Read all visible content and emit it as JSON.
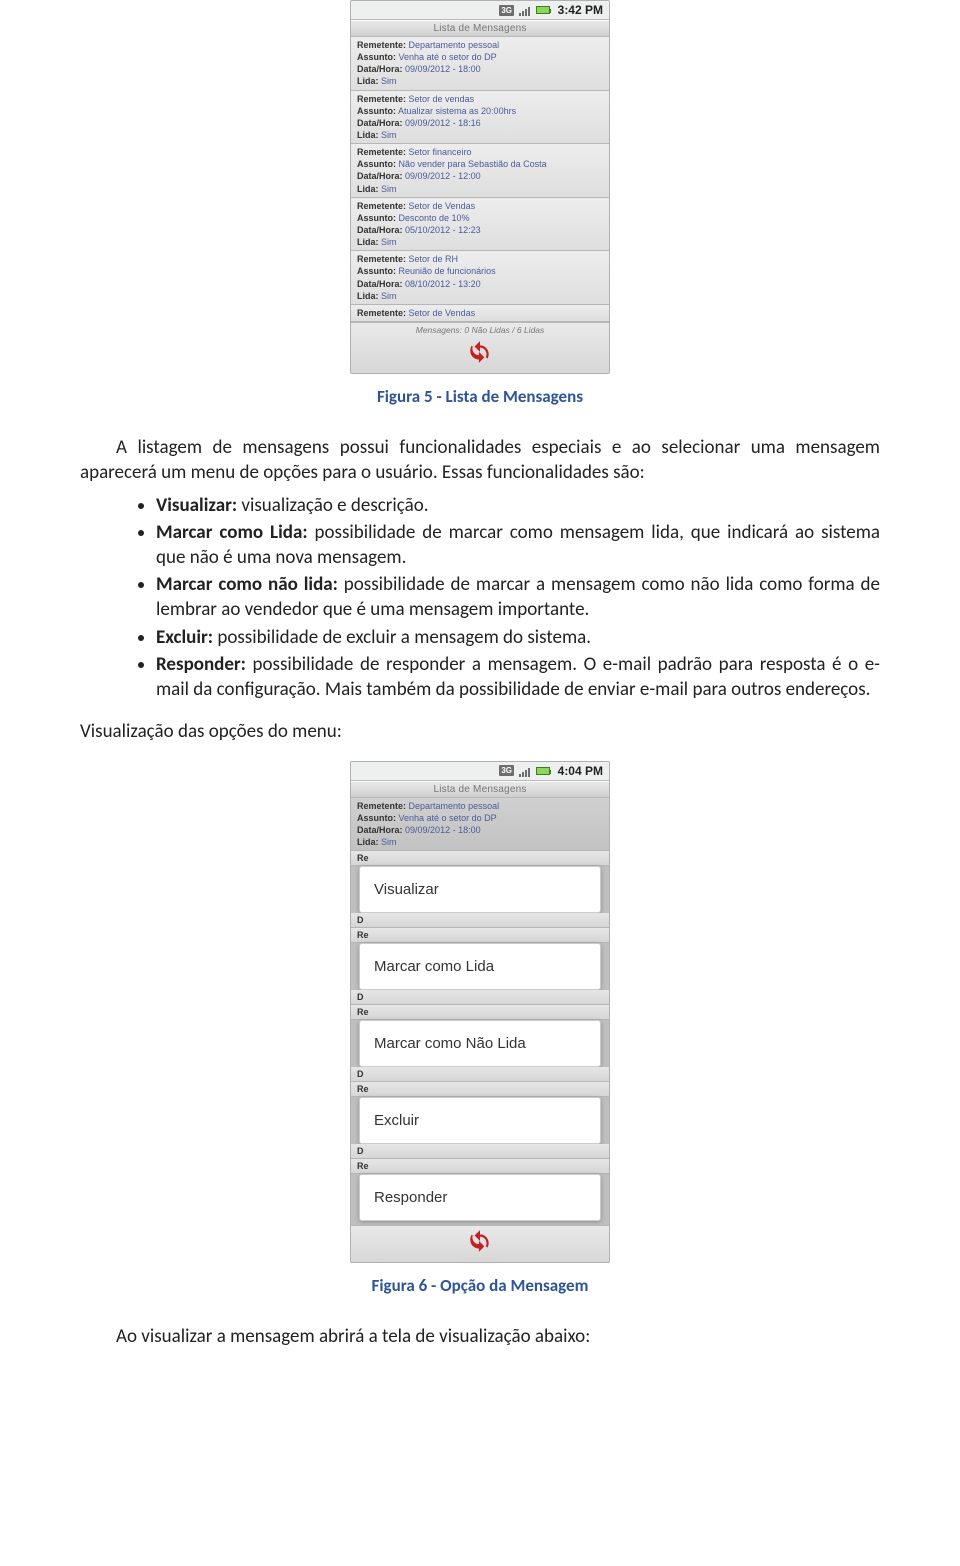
{
  "phone1": {
    "statusbar": {
      "time": "3:42 PM"
    },
    "app_title": "Lista de Mensagens",
    "messages": [
      {
        "remetente_lab": "Remetente:",
        "remetente": "Departamento pessoal",
        "assunto_lab": "Assunto:",
        "assunto": "Venha até o setor do DP",
        "datahora_lab": "Data/Hora:",
        "datahora": "09/09/2012 - 18:00",
        "lida_lab": "Lida:",
        "lida": "Sim"
      },
      {
        "remetente_lab": "Remetente:",
        "remetente": "Setor de vendas",
        "assunto_lab": "Assunto:",
        "assunto": "Atualizar sistema as 20:00hrs",
        "datahora_lab": "Data/Hora:",
        "datahora": "09/09/2012 - 18:16",
        "lida_lab": "Lida:",
        "lida": "Sim"
      },
      {
        "remetente_lab": "Remetente:",
        "remetente": "Setor financeiro",
        "assunto_lab": "Assunto:",
        "assunto": "Não vender para Sebastião da Costa",
        "datahora_lab": "Data/Hora:",
        "datahora": "09/09/2012 - 12:00",
        "lida_lab": "Lida:",
        "lida": "Sim"
      },
      {
        "remetente_lab": "Remetente:",
        "remetente": "Setor de Vendas",
        "assunto_lab": "Assunto:",
        "assunto": "Desconto de 10%",
        "datahora_lab": "Data/Hora:",
        "datahora": "05/10/2012 - 12:23",
        "lida_lab": "Lida:",
        "lida": "Sim"
      },
      {
        "remetente_lab": "Remetente:",
        "remetente": "Setor de RH",
        "assunto_lab": "Assunto:",
        "assunto": "Reunião de funcionários",
        "datahora_lab": "Data/Hora:",
        "datahora": "08/10/2012 - 13:20",
        "lida_lab": "Lida:",
        "lida": "Sim"
      },
      {
        "remetente_lab": "Remetente:",
        "remetente": "Setor de Vendas"
      }
    ],
    "footer_text": "Mensagens: 0 Não Lidas / 6 Lidas"
  },
  "caption1": "Figura 5 - Lista de Mensagens",
  "para1": "A listagem de mensagens possui funcionalidades especiais e ao selecionar uma mensagem aparecerá um menu de opções para o usuário. Essas funcionalidades são:",
  "bullets": [
    {
      "lead": "Visualizar:",
      "text": " visualização e descrição."
    },
    {
      "lead": "Marcar como Lida:",
      "text": " possibilidade de marcar como mensagem lida, que indicará ao sistema que não é uma nova mensagem."
    },
    {
      "lead": "Marcar como não lida:",
      "text": " possibilidade de marcar a mensagem como não lida como forma de lembrar ao vendedor que é uma mensagem importante."
    },
    {
      "lead": "Excluir:",
      "text": " possibilidade de excluir a mensagem do sistema."
    },
    {
      "lead": "Responder:",
      "text": " possibilidade de responder a mensagem. O e-mail padrão para resposta é o e-mail da configuração. Mais também da possibilidade de enviar e-mail para outros endereços."
    }
  ],
  "subhead": "Visualização das opções do menu:",
  "phone2": {
    "statusbar": {
      "time": "4:04 PM"
    },
    "app_title": "Lista de Mensagens",
    "header_msg": {
      "remetente_lab": "Remetente:",
      "remetente": "Departamento pessoal",
      "assunto_lab": "Assunto:",
      "assunto": "Venha até o setor do DP",
      "datahora_lab": "Data/Hora:",
      "datahora": "09/09/2012 - 18:00",
      "lida_lab": "Lida:",
      "lida": "Sim"
    },
    "dim_prefix_re": "Re",
    "dim_prefix_d": "D",
    "menu": [
      "Visualizar",
      "Marcar como Lida",
      "Marcar como Não Lida",
      "Excluir",
      "Responder"
    ]
  },
  "caption2": "Figura 6 - Opção da Mensagem",
  "para2": "Ao visualizar a mensagem abrirá a tela de visualização abaixo:"
}
